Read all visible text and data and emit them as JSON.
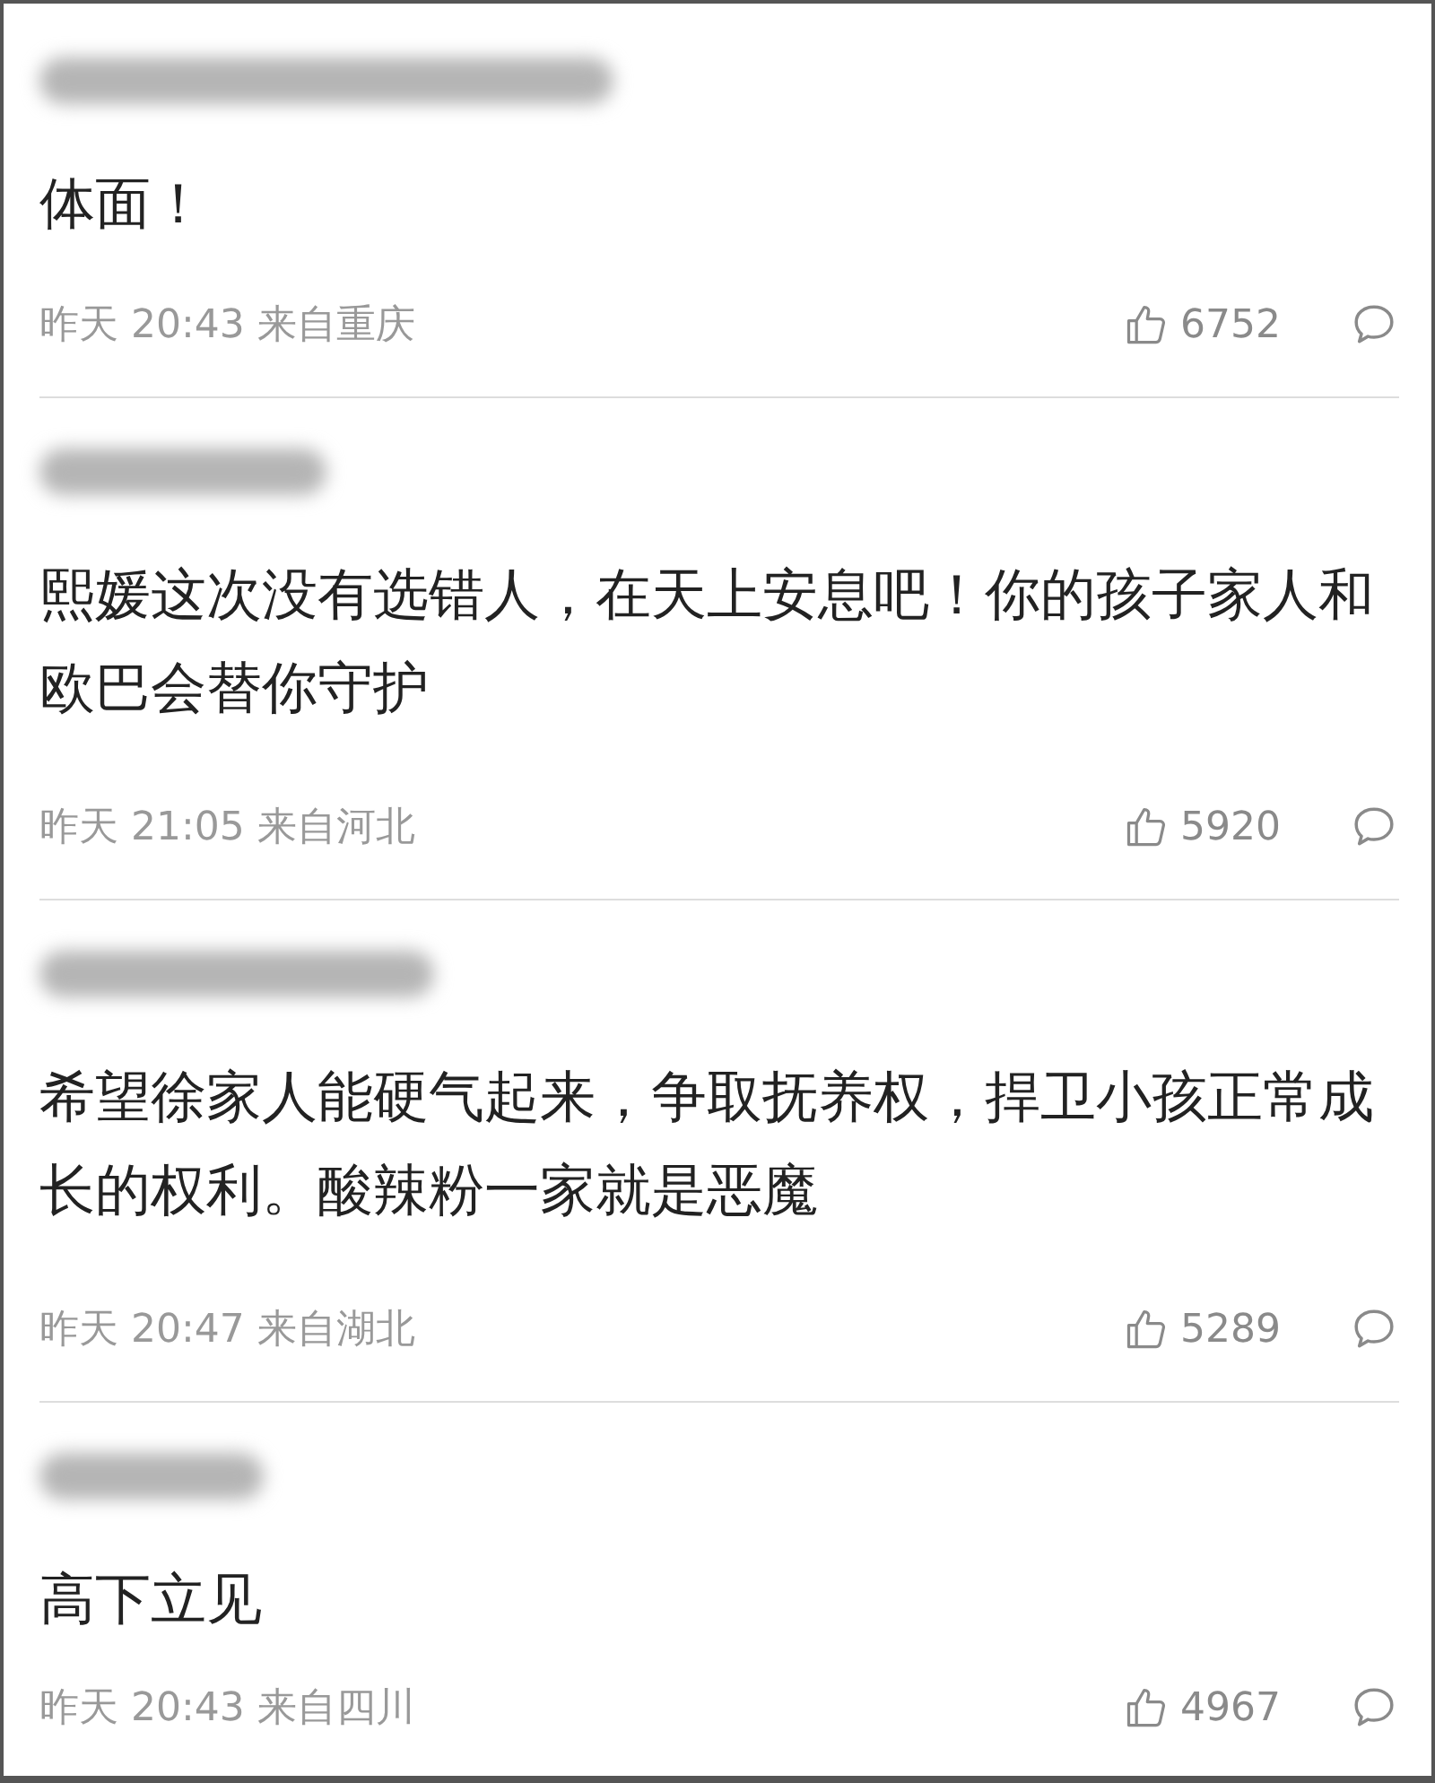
{
  "comments": [
    {
      "text": "体面！",
      "time": "昨天 20:43",
      "location": "来自重庆",
      "likes": "6752"
    },
    {
      "text": "熙媛这次没有选错人，在天上安息吧！你的孩子家人和欧巴会替你守护",
      "time": "昨天 21:05",
      "location": "来自河北",
      "likes": "5920"
    },
    {
      "text": "希望徐家人能硬气起来，争取抚养权，捍卫小孩正常成长的权利。酸辣粉一家就是恶魔",
      "time": "昨天 20:47",
      "location": "来自湖北",
      "likes": "5289"
    },
    {
      "text": "高下立见",
      "time": "昨天 20:43",
      "location": "来自四川",
      "likes": "4967"
    }
  ]
}
